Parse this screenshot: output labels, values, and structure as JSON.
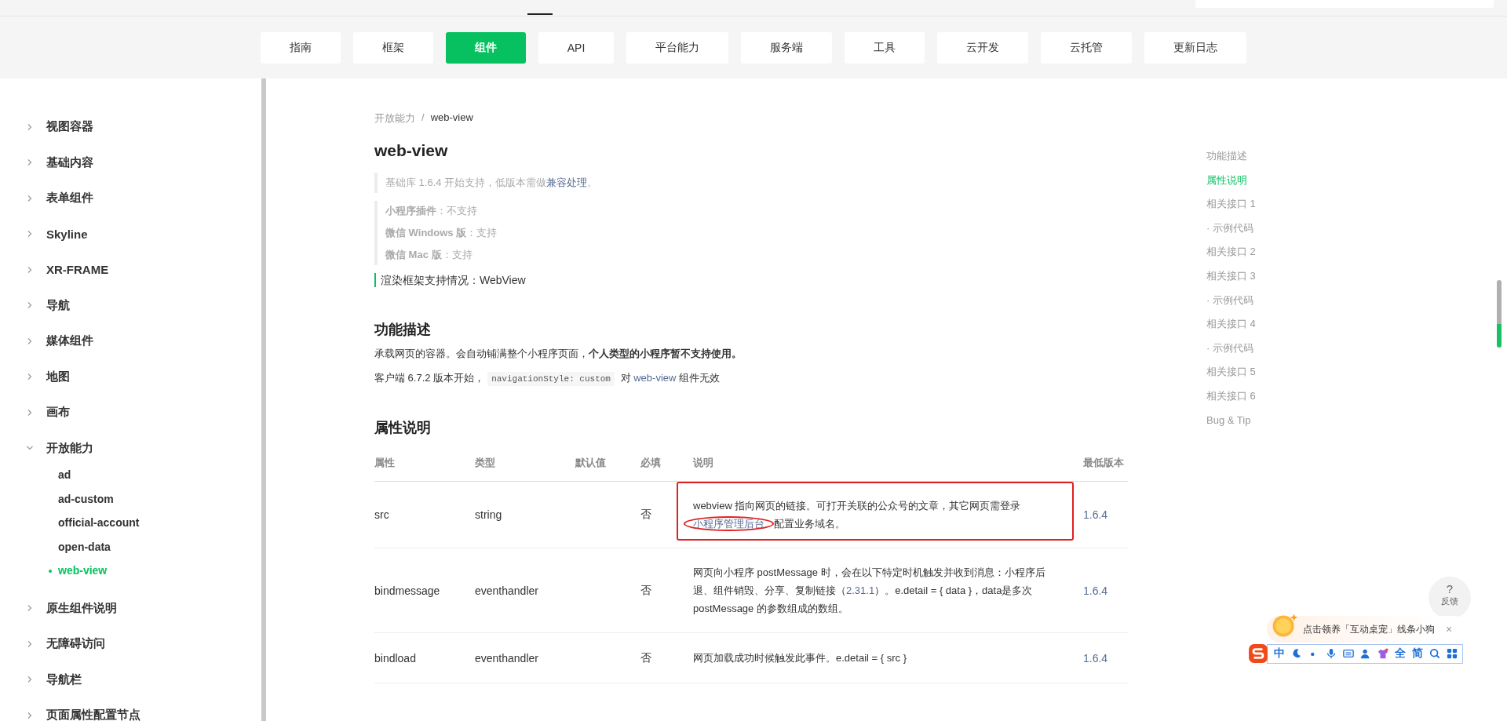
{
  "nav": [
    {
      "label": "指南",
      "selected": false
    },
    {
      "label": "框架",
      "selected": false
    },
    {
      "label": "组件",
      "selected": true
    },
    {
      "label": "API",
      "selected": false
    },
    {
      "label": "平台能力",
      "selected": false
    },
    {
      "label": "服务端",
      "selected": false
    },
    {
      "label": "工具",
      "selected": false
    },
    {
      "label": "云开发",
      "selected": false
    },
    {
      "label": "云托管",
      "selected": false
    },
    {
      "label": "更新日志",
      "selected": false
    }
  ],
  "sidebar": {
    "items": [
      {
        "label": "视图容器",
        "expanded": false
      },
      {
        "label": "基础内容",
        "expanded": false
      },
      {
        "label": "表单组件",
        "expanded": false
      },
      {
        "label": "Skyline",
        "expanded": false
      },
      {
        "label": "XR-FRAME",
        "expanded": false
      },
      {
        "label": "导航",
        "expanded": false
      },
      {
        "label": "媒体组件",
        "expanded": false
      },
      {
        "label": "地图",
        "expanded": false
      },
      {
        "label": "画布",
        "expanded": false
      },
      {
        "label": "开放能力",
        "expanded": true,
        "children": [
          {
            "label": "ad",
            "selected": false
          },
          {
            "label": "ad-custom",
            "selected": false
          },
          {
            "label": "official-account",
            "selected": false
          },
          {
            "label": "open-data",
            "selected": false
          },
          {
            "label": "web-view",
            "selected": true
          }
        ]
      },
      {
        "label": "原生组件说明",
        "expanded": false
      },
      {
        "label": "无障碍访问",
        "expanded": false
      },
      {
        "label": "导航栏",
        "expanded": false
      },
      {
        "label": "页面属性配置节点",
        "expanded": false
      }
    ]
  },
  "breadcrumb": {
    "parent": "开放能力",
    "separator": "/",
    "current": "web-view"
  },
  "title": "web-view",
  "support_note": [
    {
      "kind": "text",
      "text": "基础库 1.6.4 开始支持，低版本需做"
    },
    {
      "kind": "link",
      "text": "兼容处理"
    },
    {
      "kind": "text",
      "text": "。"
    }
  ],
  "platform_notes": [
    "**小程序插件**：不支持",
    "**微信 Windows 版**：支持",
    "**微信 Mac 版**：支持"
  ],
  "render_note": "渲染框架支持情况：WebView",
  "sections": [
    {
      "heading": "功能描述",
      "paragraphs": [
        [
          {
            "kind": "text",
            "text": "承载网页的容器。会自动铺满整个小程序页面，**个人类型的小程序暂不支持使用。**"
          }
        ],
        [
          {
            "kind": "text",
            "text": "客户端 6.7.2 版本开始，"
          },
          {
            "kind": "code",
            "text": "navigationStyle: custom"
          },
          {
            "kind": "text",
            "text": " 对 "
          },
          {
            "kind": "link",
            "text": "web-view"
          },
          {
            "kind": "text",
            "text": " 组件无效"
          }
        ]
      ]
    },
    {
      "heading": "属性说明"
    }
  ],
  "table": {
    "columns": [
      "属性",
      "类型",
      "默认值",
      "必填",
      "说明",
      "最低版本"
    ],
    "rows": [
      {
        "name": "src",
        "type": "string",
        "default": "",
        "required": "否",
        "highlighted": true,
        "description": [
          {
            "kind": "text",
            "text": "webview 指向网页的链接。可打开关联的公众号的文章，其它网页需登录"
          },
          {
            "kind": "link",
            "text": "小程序管理后台",
            "circled": true
          },
          {
            "kind": "text",
            "text": "配置业务域名。"
          }
        ],
        "version": "1.6.4"
      },
      {
        "name": "bindmessage",
        "type": "eventhandler",
        "required": "否",
        "highlighted": false,
        "description": [
          {
            "kind": "text",
            "text": "网页向小程序 postMessage 时，会在以下特定时机触发并收到消息：小程序后退、组件销毁、分享、复制链接（"
          },
          {
            "kind": "link",
            "text": "2.31.1"
          },
          {
            "kind": "text",
            "text": "）。e.detail = { data }，data是多次 postMessage 的参数组成的数组。"
          }
        ],
        "version": "1.6.4"
      },
      {
        "name": "bindload",
        "type": "eventhandler",
        "required": "否",
        "highlighted": false,
        "description": [
          {
            "kind": "text",
            "text": "网页加载成功时候触发此事件。e.detail = { src }"
          }
        ],
        "version": "1.6.4"
      }
    ]
  },
  "toc": [
    {
      "label": "功能描述",
      "selected": false
    },
    {
      "label": "属性说明",
      "selected": true
    },
    {
      "label": "相关接口 1",
      "selected": false
    },
    {
      "label": "· 示例代码",
      "selected": false
    },
    {
      "label": "相关接口 2",
      "selected": false
    },
    {
      "label": "相关接口 3",
      "selected": false
    },
    {
      "label": "· 示例代码",
      "selected": false
    },
    {
      "label": "相关接口 4",
      "selected": false
    },
    {
      "label": "· 示例代码",
      "selected": false
    },
    {
      "label": "相关接口 5",
      "selected": false
    },
    {
      "label": "相关接口 6",
      "selected": false
    },
    {
      "label": "Bug & Tip",
      "selected": false
    }
  ],
  "feedback": {
    "icon": "?",
    "label": "反馈"
  },
  "ime_tip": {
    "text": "点击领养「互动桌宠」线条小狗",
    "close": "×"
  },
  "ime_bar": {
    "chars": [
      "中",
      "全",
      "简"
    ]
  }
}
